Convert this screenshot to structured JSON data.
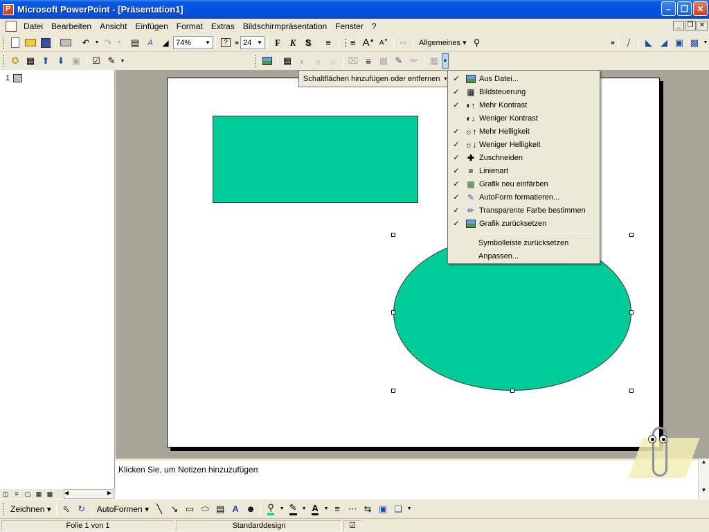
{
  "window": {
    "title": "Microsoft PowerPoint - [Präsentation1]"
  },
  "menubar": {
    "items": [
      "Datei",
      "Bearbeiten",
      "Ansicht",
      "Einfügen",
      "Format",
      "Extras",
      "Bildschirmpräsentation",
      "Fenster",
      "?"
    ]
  },
  "toolbar1": {
    "zoom_value": "74%",
    "font_size_value": "24",
    "bold_label": "F",
    "italic_label": "K",
    "shadow_label": "S",
    "layout_label": "Allgemeines"
  },
  "slides_panel": {
    "slide_number": "1"
  },
  "notes": {
    "placeholder_text": "Klicken Sie, um Notizen hinzuzufügen"
  },
  "add_remove_button": {
    "label": "Schaltflächen hinzufügen oder entfernen"
  },
  "dropdown": {
    "items": [
      {
        "label": "Aus Datei...",
        "checked": true,
        "icon": "insert-picture-icon"
      },
      {
        "label": "Bildsteuerung",
        "checked": true,
        "icon": "image-control-icon"
      },
      {
        "label": "Mehr Kontrast",
        "checked": true,
        "icon": "more-contrast-icon"
      },
      {
        "label": "Weniger Kontrast",
        "checked": false,
        "icon": "less-contrast-icon"
      },
      {
        "label": "Mehr Helligkeit",
        "checked": true,
        "icon": "more-brightness-icon"
      },
      {
        "label": "Weniger Helligkeit",
        "checked": true,
        "icon": "less-brightness-icon"
      },
      {
        "label": "Zuschneiden",
        "checked": true,
        "icon": "crop-icon"
      },
      {
        "label": "Linienart",
        "checked": true,
        "icon": "line-style-icon"
      },
      {
        "label": "Grafik neu einfärben",
        "checked": true,
        "icon": "recolor-picture-icon"
      },
      {
        "label": "AutoForm formatieren...",
        "checked": true,
        "icon": "format-autoshape-icon"
      },
      {
        "label": "Transparente Farbe bestimmen",
        "checked": true,
        "icon": "set-transparent-color-icon"
      },
      {
        "label": "Grafik zurücksetzen",
        "checked": true,
        "icon": "reset-picture-icon"
      }
    ],
    "reset_toolbar_label": "Symbolleiste zurücksetzen",
    "customize_label": "Anpassen..."
  },
  "drawing_toolbar": {
    "draw_label": "Zeichnen",
    "autoshapes_label": "AutoFormen"
  },
  "statusbar": {
    "slide_info": "Folie 1 von 1",
    "design": "Standarddesign"
  },
  "colors": {
    "shape_fill": "#00cc99",
    "title_bar": "#0054e3",
    "workspace": "#a8a497"
  }
}
